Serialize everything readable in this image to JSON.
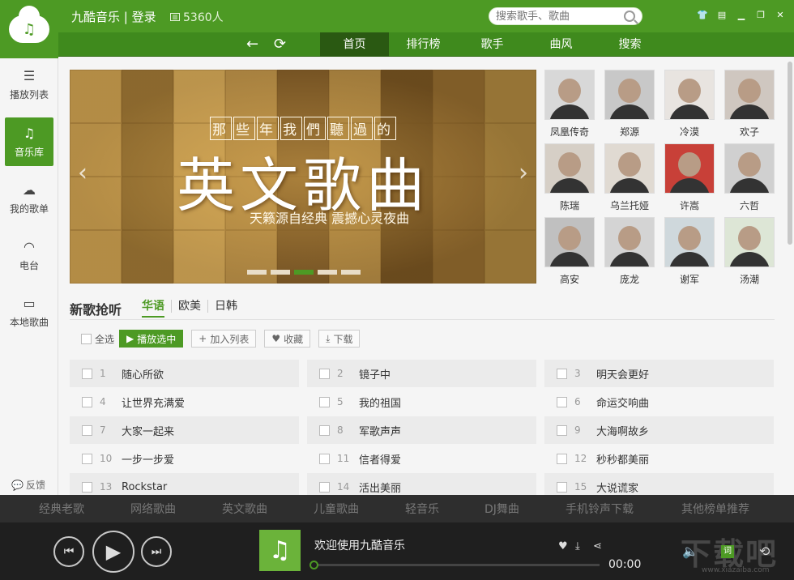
{
  "app": {
    "title": "九酷音乐 | 登录",
    "online_count": "5360人"
  },
  "search": {
    "placeholder": "搜索歌手、歌曲"
  },
  "nav": {
    "back": "←",
    "refresh": "⟳",
    "tabs": [
      {
        "label": "首页",
        "active": true
      },
      {
        "label": "排行榜"
      },
      {
        "label": "歌手"
      },
      {
        "label": "曲风"
      },
      {
        "label": "搜索"
      }
    ]
  },
  "sidebar": {
    "items": [
      {
        "label": "播放列表",
        "icon": "list-icon"
      },
      {
        "label": "音乐库",
        "icon": "music-note-icon",
        "active": true
      },
      {
        "label": "我的歌单",
        "icon": "cloud-icon"
      },
      {
        "label": "电台",
        "icon": "wifi-icon"
      },
      {
        "label": "本地歌曲",
        "icon": "monitor-icon"
      }
    ],
    "feedback": "反馈"
  },
  "banner": {
    "subtitle": [
      "那",
      "些",
      "年",
      "我",
      "們",
      "聽",
      "過",
      "的"
    ],
    "title": "英文歌曲",
    "slogan": "天籁源自经典 震撼心灵夜曲",
    "active_slide": 3,
    "slide_count": 5
  },
  "artists": [
    "凤凰传奇",
    "郑源",
    "冷漠",
    "欢子",
    "陈瑞",
    "乌兰托娅",
    "许嵩",
    "六哲",
    "高安",
    "庞龙",
    "谢军",
    "汤潮"
  ],
  "new_songs": {
    "title": "新歌抢听",
    "lang_tabs": [
      "华语",
      "欧美",
      "日韩"
    ],
    "actions": {
      "select_all": "全选",
      "play_selected": "播放选中",
      "add_to_list": "加入列表",
      "favorite": "收藏",
      "download": "下载"
    },
    "songs": [
      {
        "num": "1",
        "title": "随心所欲"
      },
      {
        "num": "2",
        "title": "镜子中"
      },
      {
        "num": "3",
        "title": "明天会更好"
      },
      {
        "num": "4",
        "title": "让世界充满爱"
      },
      {
        "num": "5",
        "title": "我的祖国"
      },
      {
        "num": "6",
        "title": "命运交响曲"
      },
      {
        "num": "7",
        "title": "大家一起来"
      },
      {
        "num": "8",
        "title": "军歌声声"
      },
      {
        "num": "9",
        "title": "大海啊故乡"
      },
      {
        "num": "10",
        "title": "一步一步爱"
      },
      {
        "num": "11",
        "title": "信者得爱"
      },
      {
        "num": "12",
        "title": "秒秒都美丽"
      },
      {
        "num": "13",
        "title": "Rockstar"
      },
      {
        "num": "14",
        "title": "活出美丽"
      },
      {
        "num": "15",
        "title": "大说谎家"
      }
    ]
  },
  "categories": [
    "经典老歌",
    "网络歌曲",
    "英文歌曲",
    "儿童歌曲",
    "轻音乐",
    "DJ舞曲",
    "手机铃声下载",
    "其他榜单推荐"
  ],
  "player": {
    "now_playing": "欢迎使用九酷音乐",
    "time": "00:00",
    "lyric_label": "词",
    "progress": 0
  },
  "watermark": {
    "text": "下载吧",
    "sub": "www.xiazaiba.com"
  },
  "colors": {
    "brand": "#4d9a24",
    "nav_dark": "#3f8a1d",
    "player_bg": "#1f1f1f"
  }
}
